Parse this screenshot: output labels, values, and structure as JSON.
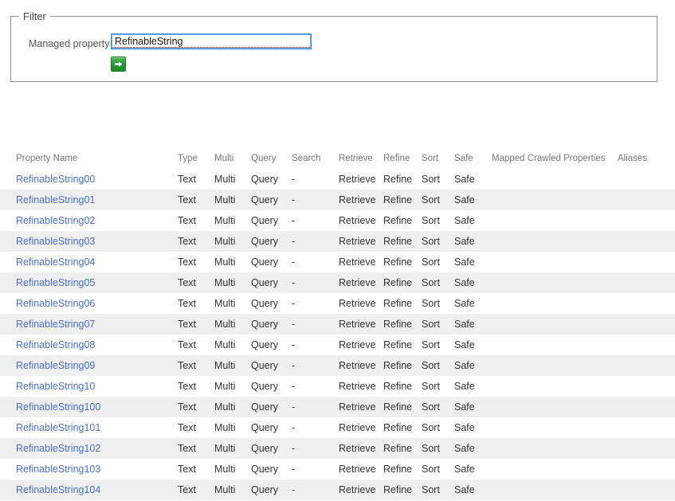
{
  "filter": {
    "legend": "Filter",
    "managed_property_label": "Managed property",
    "managed_property_value": "RefinableString",
    "managed_property_placeholder": "",
    "go_button_label": "",
    "go_icon": "arrow-right-icon",
    "accent_green": "#2c9b33",
    "focus_blue": "#3f8ede"
  },
  "table": {
    "columns": [
      "Property Name",
      "Type",
      "Multi",
      "Query",
      "Search",
      "Retrieve",
      "Refine",
      "Sort",
      "Safe",
      "Mapped Crawled Properties",
      "Aliases"
    ],
    "link_color": "#4b6fce",
    "alt_row_color": "#efefef",
    "rows": [
      {
        "name": "RefinableString00",
        "type": "Text",
        "multi": "Multi",
        "query": "Query",
        "search": "-",
        "retrieve": "Retrieve",
        "refine": "Refine",
        "sort": "Sort",
        "safe": "Safe",
        "mapped": "",
        "aliases": ""
      },
      {
        "name": "RefinableString01",
        "type": "Text",
        "multi": "Multi",
        "query": "Query",
        "search": "-",
        "retrieve": "Retrieve",
        "refine": "Refine",
        "sort": "Sort",
        "safe": "Safe",
        "mapped": "",
        "aliases": ""
      },
      {
        "name": "RefinableString02",
        "type": "Text",
        "multi": "Multi",
        "query": "Query",
        "search": "-",
        "retrieve": "Retrieve",
        "refine": "Refine",
        "sort": "Sort",
        "safe": "Safe",
        "mapped": "",
        "aliases": ""
      },
      {
        "name": "RefinableString03",
        "type": "Text",
        "multi": "Multi",
        "query": "Query",
        "search": "-",
        "retrieve": "Retrieve",
        "refine": "Refine",
        "sort": "Sort",
        "safe": "Safe",
        "mapped": "",
        "aliases": ""
      },
      {
        "name": "RefinableString04",
        "type": "Text",
        "multi": "Multi",
        "query": "Query",
        "search": "-",
        "retrieve": "Retrieve",
        "refine": "Refine",
        "sort": "Sort",
        "safe": "Safe",
        "mapped": "",
        "aliases": ""
      },
      {
        "name": "RefinableString05",
        "type": "Text",
        "multi": "Multi",
        "query": "Query",
        "search": "-",
        "retrieve": "Retrieve",
        "refine": "Refine",
        "sort": "Sort",
        "safe": "Safe",
        "mapped": "",
        "aliases": ""
      },
      {
        "name": "RefinableString06",
        "type": "Text",
        "multi": "Multi",
        "query": "Query",
        "search": "-",
        "retrieve": "Retrieve",
        "refine": "Refine",
        "sort": "Sort",
        "safe": "Safe",
        "mapped": "",
        "aliases": ""
      },
      {
        "name": "RefinableString07",
        "type": "Text",
        "multi": "Multi",
        "query": "Query",
        "search": "-",
        "retrieve": "Retrieve",
        "refine": "Refine",
        "sort": "Sort",
        "safe": "Safe",
        "mapped": "",
        "aliases": ""
      },
      {
        "name": "RefinableString08",
        "type": "Text",
        "multi": "Multi",
        "query": "Query",
        "search": "-",
        "retrieve": "Retrieve",
        "refine": "Refine",
        "sort": "Sort",
        "safe": "Safe",
        "mapped": "",
        "aliases": ""
      },
      {
        "name": "RefinableString09",
        "type": "Text",
        "multi": "Multi",
        "query": "Query",
        "search": "-",
        "retrieve": "Retrieve",
        "refine": "Refine",
        "sort": "Sort",
        "safe": "Safe",
        "mapped": "",
        "aliases": ""
      },
      {
        "name": "RefinableString10",
        "type": "Text",
        "multi": "Multi",
        "query": "Query",
        "search": "-",
        "retrieve": "Retrieve",
        "refine": "Refine",
        "sort": "Sort",
        "safe": "Safe",
        "mapped": "",
        "aliases": ""
      },
      {
        "name": "RefinableString100",
        "type": "Text",
        "multi": "Multi",
        "query": "Query",
        "search": "-",
        "retrieve": "Retrieve",
        "refine": "Refine",
        "sort": "Sort",
        "safe": "Safe",
        "mapped": "",
        "aliases": ""
      },
      {
        "name": "RefinableString101",
        "type": "Text",
        "multi": "Multi",
        "query": "Query",
        "search": "-",
        "retrieve": "Retrieve",
        "refine": "Refine",
        "sort": "Sort",
        "safe": "Safe",
        "mapped": "",
        "aliases": ""
      },
      {
        "name": "RefinableString102",
        "type": "Text",
        "multi": "Multi",
        "query": "Query",
        "search": "-",
        "retrieve": "Retrieve",
        "refine": "Refine",
        "sort": "Sort",
        "safe": "Safe",
        "mapped": "",
        "aliases": ""
      },
      {
        "name": "RefinableString103",
        "type": "Text",
        "multi": "Multi",
        "query": "Query",
        "search": "-",
        "retrieve": "Retrieve",
        "refine": "Refine",
        "sort": "Sort",
        "safe": "Safe",
        "mapped": "",
        "aliases": ""
      },
      {
        "name": "RefinableString104",
        "type": "Text",
        "multi": "Multi",
        "query": "Query",
        "search": "-",
        "retrieve": "Retrieve",
        "refine": "Refine",
        "sort": "Sort",
        "safe": "Safe",
        "mapped": "",
        "aliases": ""
      }
    ]
  }
}
